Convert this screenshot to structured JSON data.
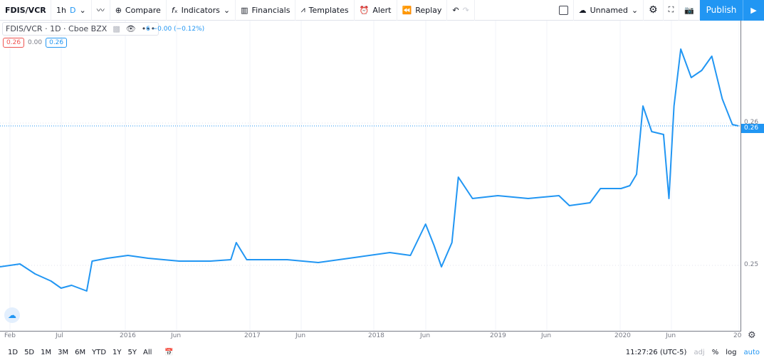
{
  "toolbar": {
    "symbol": "FDIS/VCR",
    "interval_1h": "1h",
    "interval_d": "D",
    "compare": "Compare",
    "indicators": "Indicators",
    "financials": "Financials",
    "templates": "Templates",
    "alert": "Alert",
    "replay": "Replay",
    "layout_name": "Unnamed",
    "publish": "Publish"
  },
  "legend": {
    "title": "FDIS/VCR · 1D · Cboe BZX",
    "change": "6 −0.00 (−0.12%)",
    "bid": "0.26",
    "spread": "0.00",
    "ask": "0.26"
  },
  "price_axis": {
    "ticks": [
      "0.26",
      "0.25"
    ],
    "last_price": "0.26"
  },
  "time_axis": {
    "ticks": [
      "Feb",
      "Jul",
      "2016",
      "Jun",
      "2017",
      "Jun",
      "2018",
      "Jun",
      "2019",
      "Jun",
      "2020",
      "Jun",
      "20"
    ]
  },
  "bottom": {
    "ranges": [
      "1D",
      "5D",
      "1M",
      "3M",
      "6M",
      "YTD",
      "1Y",
      "5Y",
      "All"
    ],
    "clock": "11:27:26 (UTC-5)",
    "adj": "adj",
    "pct": "%",
    "log": "log",
    "auto": "auto"
  },
  "colors": {
    "line": "#2196f3",
    "accent": "#2196f3",
    "down": "#ef5350"
  },
  "chart_data": {
    "type": "line",
    "yticks": [
      0.25,
      0.26
    ],
    "ylim": [
      0.247,
      0.2715
    ],
    "xlim": [
      "2015-01-01",
      "2021-01-03"
    ],
    "grid": true,
    "dates": [
      "2015-01-01",
      "2015-03-01",
      "2015-04-15",
      "2015-06-01",
      "2015-07-01",
      "2015-08-01",
      "2015-09-15",
      "2015-10-01",
      "2015-11-15",
      "2016-01-15",
      "2016-03-15",
      "2016-06-15",
      "2016-09-15",
      "2016-11-15",
      "2016-12-01",
      "2017-01-01",
      "2017-05-01",
      "2017-08-01",
      "2017-12-01",
      "2018-03-01",
      "2018-05-01",
      "2018-06-15",
      "2018-07-10",
      "2018-08-01",
      "2018-09-01",
      "2018-09-20",
      "2018-11-01",
      "2019-01-15",
      "2019-04-15",
      "2019-07-15",
      "2019-08-15",
      "2019-10-15",
      "2019-11-15",
      "2020-01-15",
      "2020-02-10",
      "2020-03-01",
      "2020-03-20",
      "2020-04-15",
      "2020-05-20",
      "2020-06-05",
      "2020-06-20",
      "2020-07-10",
      "2020-08-10",
      "2020-09-10",
      "2020-10-10",
      "2020-11-10",
      "2020-12-10",
      "2020-12-28"
    ],
    "values": [
      0.2499,
      0.2501,
      0.2494,
      0.2489,
      0.2484,
      0.2486,
      0.2482,
      0.2503,
      0.2505,
      0.2507,
      0.2505,
      0.2503,
      0.2503,
      0.2504,
      0.2516,
      0.2504,
      0.2504,
      0.2502,
      0.2506,
      0.2509,
      0.2507,
      0.2529,
      0.2514,
      0.2499,
      0.2516,
      0.2562,
      0.2547,
      0.2549,
      0.2547,
      0.2549,
      0.2542,
      0.2544,
      0.2554,
      0.2554,
      0.2556,
      0.2564,
      0.2612,
      0.2594,
      0.2592,
      0.2547,
      0.2612,
      0.2652,
      0.2632,
      0.2637,
      0.2647,
      0.2617,
      0.2599,
      0.2598
    ]
  }
}
